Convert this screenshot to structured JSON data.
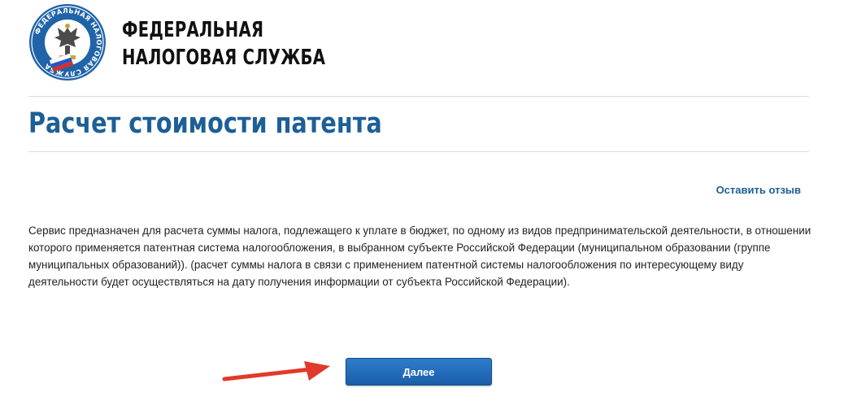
{
  "header": {
    "logo_text": "ФЕДЕРАЛЬНАЯ НАЛОГОВАЯ СЛУЖБА",
    "org_name_line1": "ФЕДЕРАЛЬНАЯ",
    "org_name_line2": "НАЛОГОВАЯ СЛУЖБА"
  },
  "page": {
    "title": "Расчет стоимости патента",
    "feedback_link": "Оставить отзыв",
    "description": "Сервис предназначен для расчета суммы налога, подлежащего к уплате в бюджет, по одному из видов предпринимательской деятельности, в отношении которого применяется патентная система налогообложения, в выбранном субъекте Российской Федерации (муниципальном образовании (группе муниципальных образований)). (расчет суммы налога в связи с применением патентной системы налогообложения по интересующему виду деятельности будет осуществляться на дату получения информации от субъекта Российской Федерации).",
    "next_button": "Далее"
  },
  "colors": {
    "brand_blue": "#1d5f96",
    "button_blue": "#1f66b3",
    "arrow_red": "#e03a2b"
  },
  "icons": {
    "logo": "fns-emblem-icon",
    "annotation": "red-arrow-icon"
  }
}
